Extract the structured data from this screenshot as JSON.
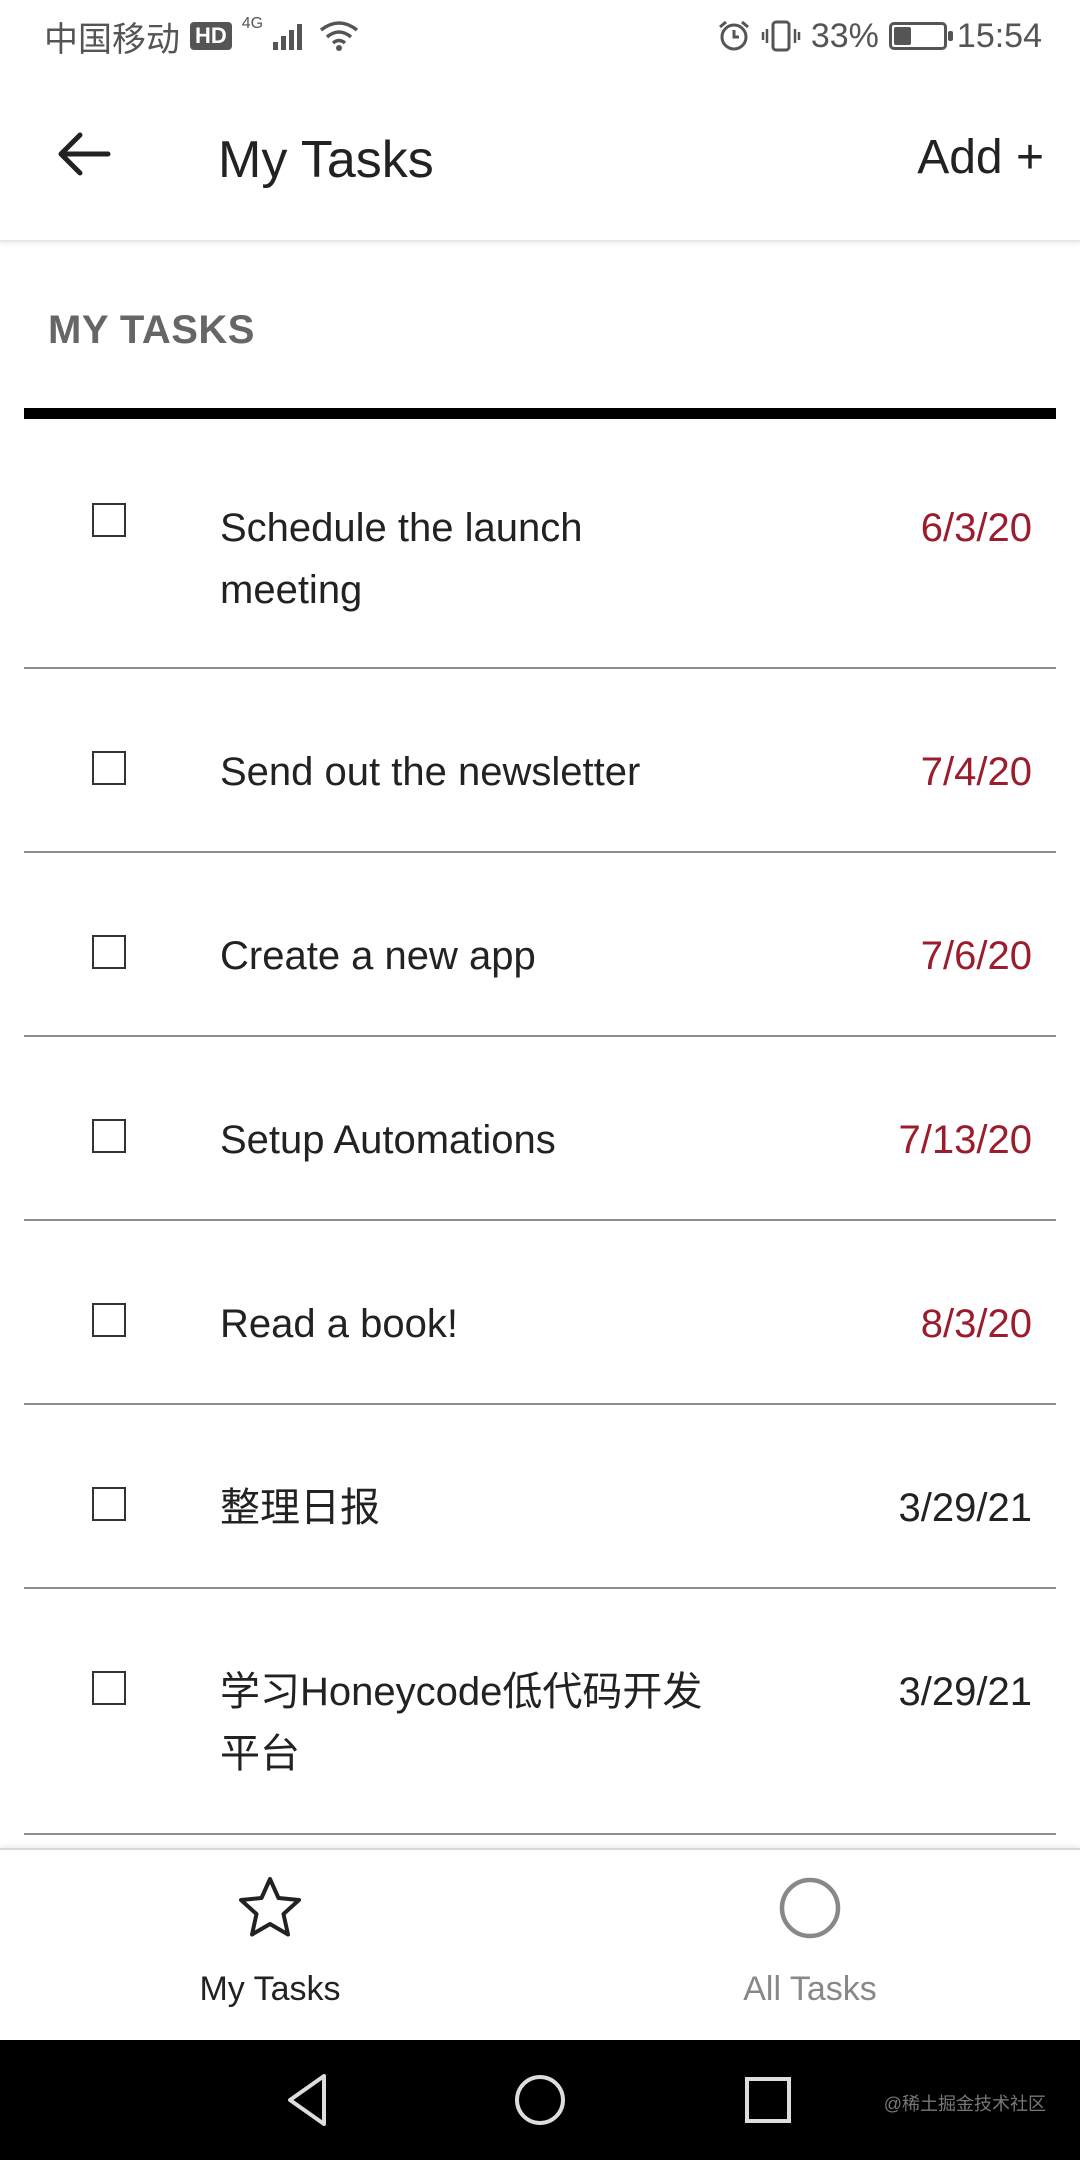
{
  "status_bar": {
    "carrier": "中国移动",
    "hd": "HD",
    "network": "4G",
    "battery": "33%",
    "battery_level": 0.33,
    "time": "15:54"
  },
  "header": {
    "title": "My Tasks",
    "add_label": "Add +"
  },
  "section": {
    "title": "MY TASKS"
  },
  "tasks": [
    {
      "title": "Schedule the launch meeting",
      "date": "6/3/20",
      "overdue": true
    },
    {
      "title": "Send out the newsletter",
      "date": "7/4/20",
      "overdue": true
    },
    {
      "title": "Create a new app",
      "date": "7/6/20",
      "overdue": true
    },
    {
      "title": "Setup Automations",
      "date": "7/13/20",
      "overdue": true
    },
    {
      "title": "Read a book!",
      "date": "8/3/20",
      "overdue": true
    },
    {
      "title": "整理日报",
      "date": "3/29/21",
      "overdue": false
    },
    {
      "title": "学习Honeycode低代码开发平台",
      "date": "3/29/21",
      "overdue": false
    }
  ],
  "bottom_nav": {
    "my_tasks": {
      "label": "My Tasks",
      "icon": "star-icon"
    },
    "all_tasks": {
      "label": "All Tasks",
      "icon": "circle-icon"
    }
  },
  "watermark": "@稀土掘金技术社区",
  "colors": {
    "overdue_date": "#9b1c2c",
    "normal_date": "#222222",
    "inactive_nav": "#888888"
  }
}
